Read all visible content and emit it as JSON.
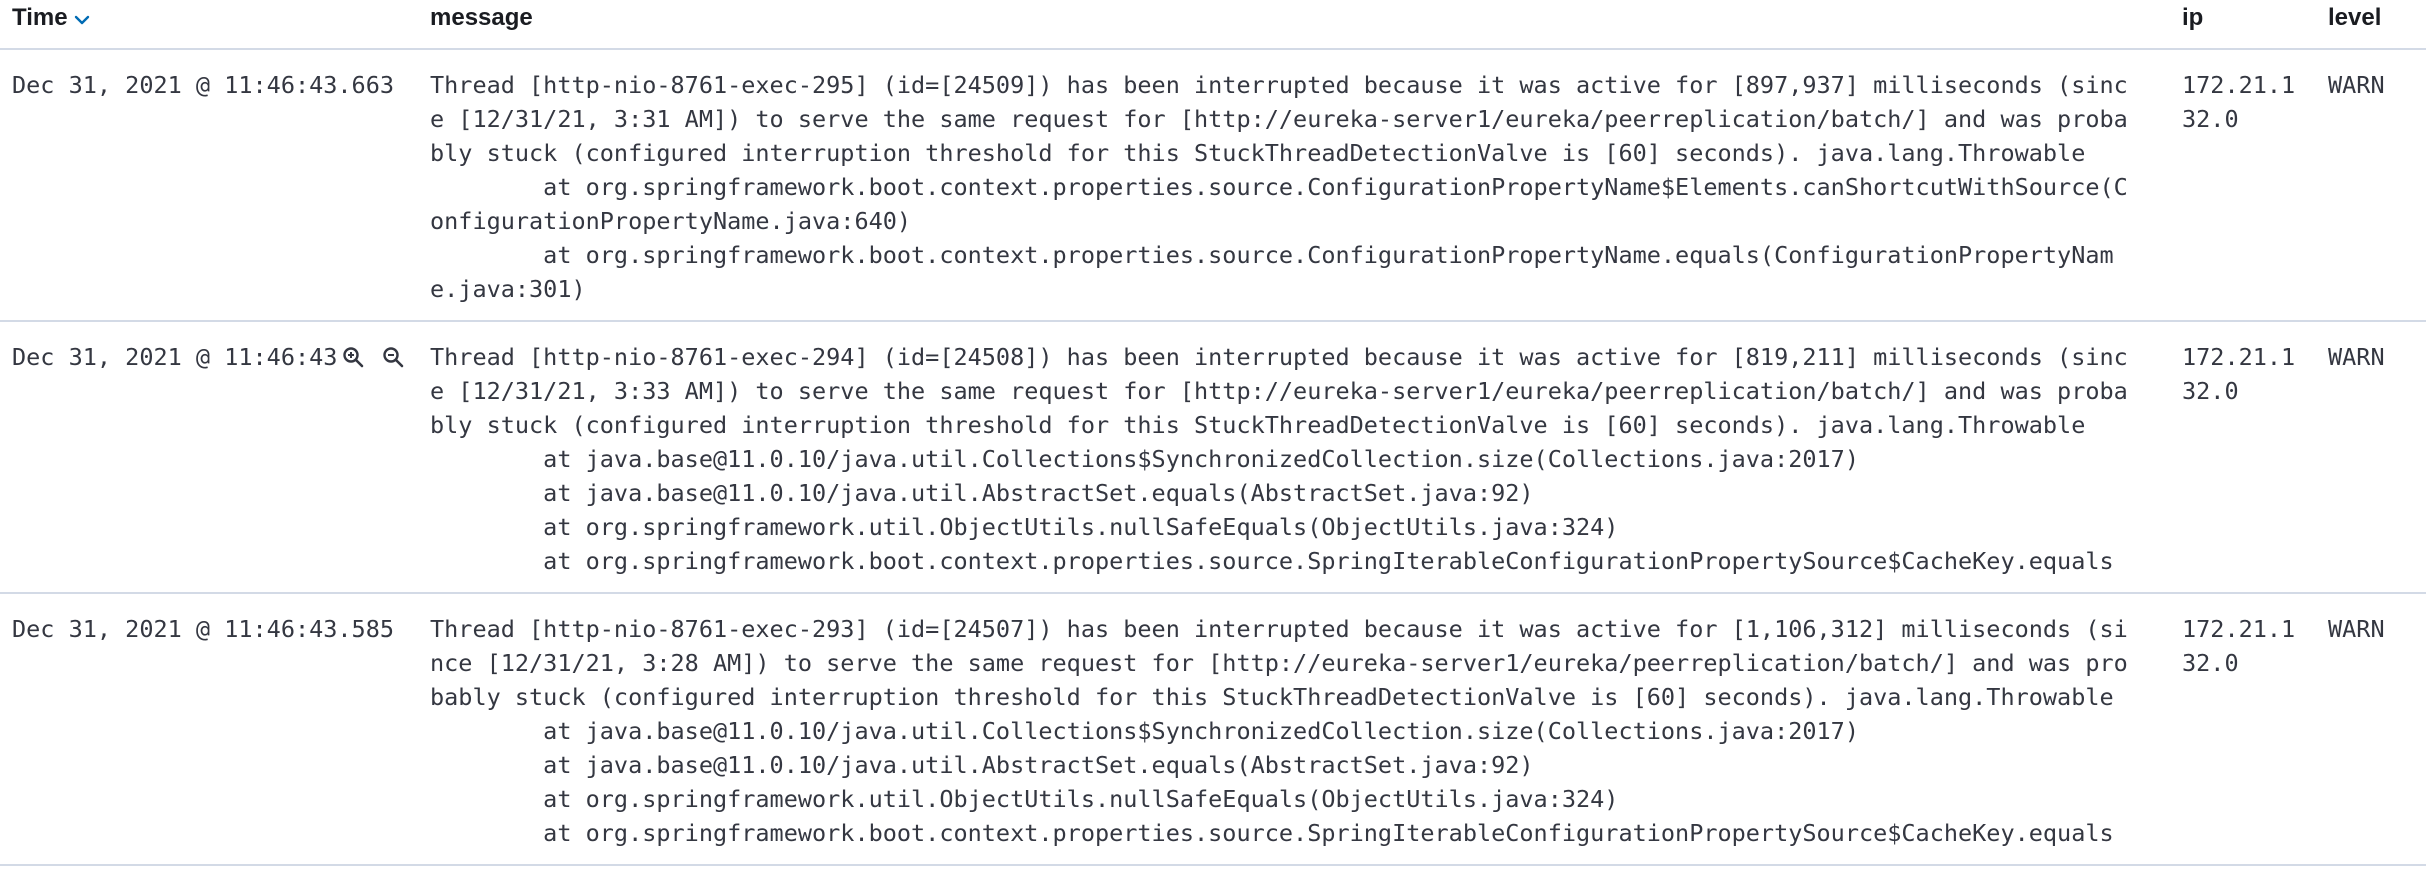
{
  "table": {
    "columns": {
      "time": "Time",
      "message": "message",
      "ip": "ip",
      "level": "level"
    },
    "sort_icon": "caret-down-icon",
    "rows": [
      {
        "time": "Dec 31, 2021 @ 11:46:43.663",
        "message_lines": [
          "Thread [http-nio-8761-exec-295] (id=[24509]) has been interrupted because it was active for [897,937] milliseconds (sinc",
          "e [12/31/21, 3:31 AM]) to serve the same request for [http://eureka-server1/eureka/peerreplication/batch/] and was proba",
          "bly stuck (configured interruption threshold for this StuckThreadDetectionValve is [60] seconds). java.lang.Throwable",
          "        at org.springframework.boot.context.properties.source.ConfigurationPropertyName$Elements.canShortcutWithSource(C",
          "onfigurationPropertyName.java:640)",
          "        at org.springframework.boot.context.properties.source.ConfigurationPropertyName.equals(ConfigurationPropertyNam",
          "e.java:301)"
        ],
        "ip_lines": [
          "172.21.1",
          "32.0"
        ],
        "level": "WARN",
        "hover": false
      },
      {
        "time": "Dec 31, 2021 @ 11:46:43",
        "message_lines": [
          "Thread [http-nio-8761-exec-294] (id=[24508]) has been interrupted because it was active for [819,211] milliseconds (sinc",
          "e [12/31/21, 3:33 AM]) to serve the same request for [http://eureka-server1/eureka/peerreplication/batch/] and was proba",
          "bly stuck (configured interruption threshold for this StuckThreadDetectionValve is [60] seconds). java.lang.Throwable",
          "        at java.base@11.0.10/java.util.Collections$SynchronizedCollection.size(Collections.java:2017)",
          "        at java.base@11.0.10/java.util.AbstractSet.equals(AbstractSet.java:92)",
          "        at org.springframework.util.ObjectUtils.nullSafeEquals(ObjectUtils.java:324)",
          "        at org.springframework.boot.context.properties.source.SpringIterableConfigurationPropertySource$CacheKey.equals"
        ],
        "ip_lines": [
          "172.21.1",
          "32.0"
        ],
        "level": "WARN",
        "hover": true,
        "hover_icons": [
          "zoom-in-icon",
          "zoom-out-icon"
        ]
      },
      {
        "time": "Dec 31, 2021 @ 11:46:43.585",
        "message_lines": [
          "Thread [http-nio-8761-exec-293] (id=[24507]) has been interrupted because it was active for [1,106,312] milliseconds (si",
          "nce [12/31/21, 3:28 AM]) to serve the same request for [http://eureka-server1/eureka/peerreplication/batch/] and was pro",
          "bably stuck (configured interruption threshold for this StuckThreadDetectionValve is [60] seconds). java.lang.Throwable",
          "        at java.base@11.0.10/java.util.Collections$SynchronizedCollection.size(Collections.java:2017)",
          "        at java.base@11.0.10/java.util.AbstractSet.equals(AbstractSet.java:92)",
          "        at org.springframework.util.ObjectUtils.nullSafeEquals(ObjectUtils.java:324)",
          "        at org.springframework.boot.context.properties.source.SpringIterableConfigurationPropertySource$CacheKey.equals"
        ],
        "ip_lines": [
          "172.21.1",
          "32.0"
        ],
        "level": "WARN",
        "hover": false
      }
    ]
  }
}
